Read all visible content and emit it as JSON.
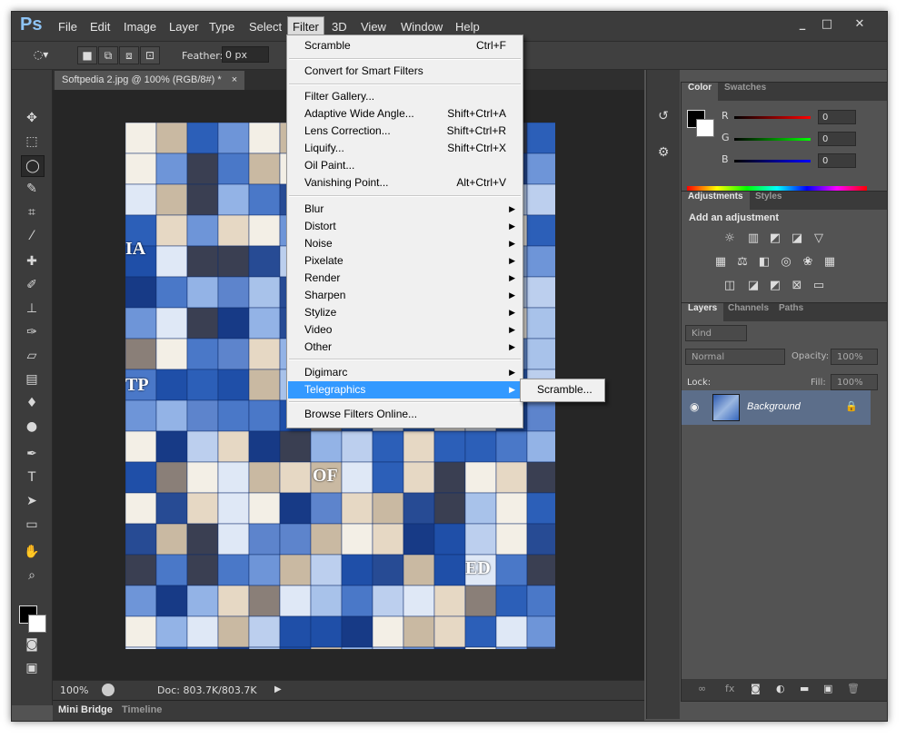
{
  "app": {
    "logo": "Ps"
  },
  "menubar": {
    "items": [
      "File",
      "Edit",
      "Image",
      "Layer",
      "Type",
      "Select",
      "Filter",
      "3D",
      "View",
      "Window",
      "Help"
    ],
    "active": "Filter"
  },
  "options": {
    "feather_label": "Feather:",
    "feather_value": "0 px"
  },
  "document": {
    "tab_title": "Softpedia 2.jpg @ 100% (RGB/8#) *",
    "zoom": "100%",
    "doc_size": "Doc: 803.7K/803.7K",
    "overlay_texts": [
      "TP",
      "OF",
      "ED",
      "IA"
    ]
  },
  "bottom_tabs": {
    "mini_bridge": "Mini Bridge",
    "timeline": "Timeline"
  },
  "filter_menu": {
    "group1": [
      {
        "label": "Scramble",
        "shortcut": "Ctrl+F"
      }
    ],
    "group2": [
      {
        "label": "Convert for Smart Filters"
      }
    ],
    "group3": [
      {
        "label": "Filter Gallery..."
      },
      {
        "label": "Adaptive Wide Angle...",
        "shortcut": "Shift+Ctrl+A"
      },
      {
        "label": "Lens Correction...",
        "shortcut": "Shift+Ctrl+R"
      },
      {
        "label": "Liquify...",
        "shortcut": "Shift+Ctrl+X"
      },
      {
        "label": "Oil Paint..."
      },
      {
        "label": "Vanishing Point...",
        "shortcut": "Alt+Ctrl+V"
      }
    ],
    "group4": [
      "Blur",
      "Distort",
      "Noise",
      "Pixelate",
      "Render",
      "Sharpen",
      "Stylize",
      "Video",
      "Other"
    ],
    "group5": [
      "Digimarc",
      "Telegraphics"
    ],
    "group6": [
      {
        "label": "Browse Filters Online..."
      }
    ],
    "highlighted": "Telegraphics",
    "submenu_item": "Scramble..."
  },
  "color_panel": {
    "tabs": [
      "Color",
      "Swatches"
    ],
    "channels": [
      {
        "name": "R",
        "value": "0"
      },
      {
        "name": "G",
        "value": "0"
      },
      {
        "name": "B",
        "value": "0"
      }
    ],
    "colors": {
      "fg": "#000000",
      "bg": "#ffffff"
    }
  },
  "adjustments_panel": {
    "tabs": [
      "Adjustments",
      "Styles"
    ],
    "title": "Add an adjustment"
  },
  "layers_panel": {
    "tabs": [
      "Layers",
      "Channels",
      "Paths"
    ],
    "kind_filter": "Kind",
    "blend_mode": "Normal",
    "opacity_label": "Opacity:",
    "opacity_value": "100%",
    "lock_label": "Lock:",
    "fill_label": "Fill:",
    "fill_value": "100%",
    "layers": [
      {
        "name": "Background",
        "visible": true,
        "locked": true
      }
    ]
  }
}
